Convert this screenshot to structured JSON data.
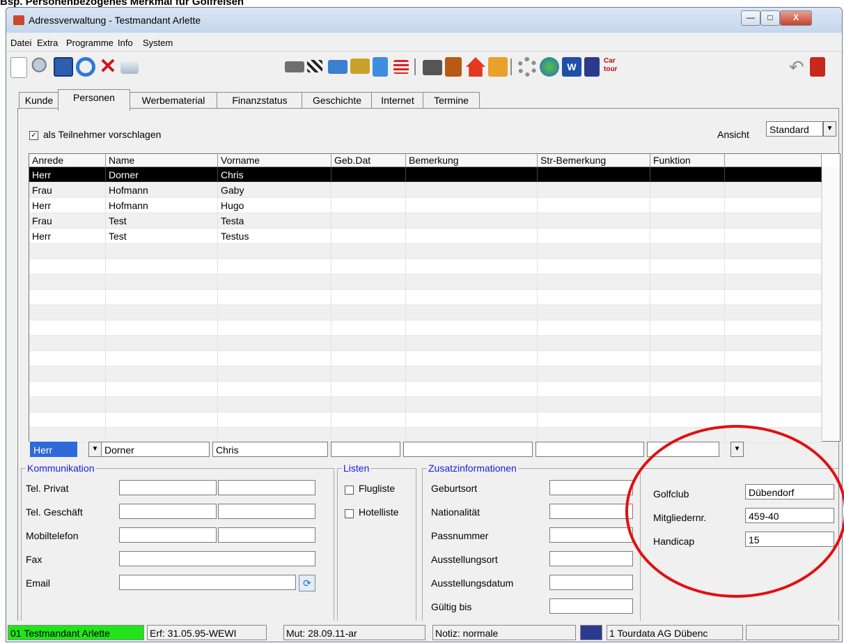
{
  "caption": "Bsp. Personenbezogenes Merkmal für Golfreisen",
  "window": {
    "title": "Adressverwaltung - Testmandant Arlette",
    "min": "—",
    "max": "□",
    "close": "X"
  },
  "menu": [
    "Datei",
    "Extra",
    "Programme",
    "Info",
    "System"
  ],
  "toolbar": {
    "car_tour_label": "Car tour"
  },
  "tabs": [
    "Kunde",
    "Personen",
    "Werbematerial",
    "Finanzstatus",
    "Geschichte",
    "Internet",
    "Termine"
  ],
  "options": {
    "suggest_participant_label": "als Teilnehmer vorschlagen",
    "suggest_participant_checked": "✓"
  },
  "view": {
    "label": "Ansicht",
    "value": "Standard"
  },
  "grid": {
    "columns": [
      "Anrede",
      "Name",
      "Vorname",
      "Geb.Dat",
      "Bemerkung",
      "Str-Bemerkung",
      "Funktion"
    ],
    "rows": [
      [
        "Herr",
        "Dorner",
        "Chris",
        "",
        "",
        "",
        ""
      ],
      [
        "Frau",
        "Hofmann",
        "Gaby",
        "",
        "",
        "",
        ""
      ],
      [
        "Herr",
        "Hofmann",
        "Hugo",
        "",
        "",
        "",
        ""
      ],
      [
        "Frau",
        "Test",
        "Testa",
        "",
        "",
        "",
        ""
      ],
      [
        "Herr",
        "Test",
        "Testus",
        "",
        "",
        "",
        ""
      ]
    ]
  },
  "edit": {
    "anrede": "Herr",
    "name": "Dorner",
    "vorname": "Chris"
  },
  "kommunikation": {
    "title": "Kommunikation",
    "labels": [
      "Tel. Privat",
      "Tel. Geschäft",
      "Mobiltelefon",
      "Fax",
      "Email"
    ]
  },
  "listen": {
    "title": "Listen",
    "items": [
      "Flugliste",
      "Hotelliste"
    ]
  },
  "zusatz": {
    "title": "Zusatzinformationen",
    "labels": [
      "Geburtsort",
      "Nationalität",
      "Passnummer",
      "Ausstellungsort",
      "Ausstellungsdatum",
      "Gültig bis"
    ]
  },
  "golf": {
    "labels": [
      "Golfclub",
      "Mitgliedernr.",
      "Handicap"
    ],
    "values": [
      "Dübendorf",
      "459-40",
      "15"
    ]
  },
  "status": {
    "mandant": "01 Testmandant Arlette",
    "erf": "Erf: 31.05.95-WEWI",
    "mut": "Mut: 28.09.11-ar",
    "notiz": "Notiz: normale",
    "office": "1  Tourdata AG Dübenc"
  },
  "colors": {
    "status_green": "#22e41a",
    "accent_red": "#e11010",
    "link_blue": "#1a1ae0"
  }
}
